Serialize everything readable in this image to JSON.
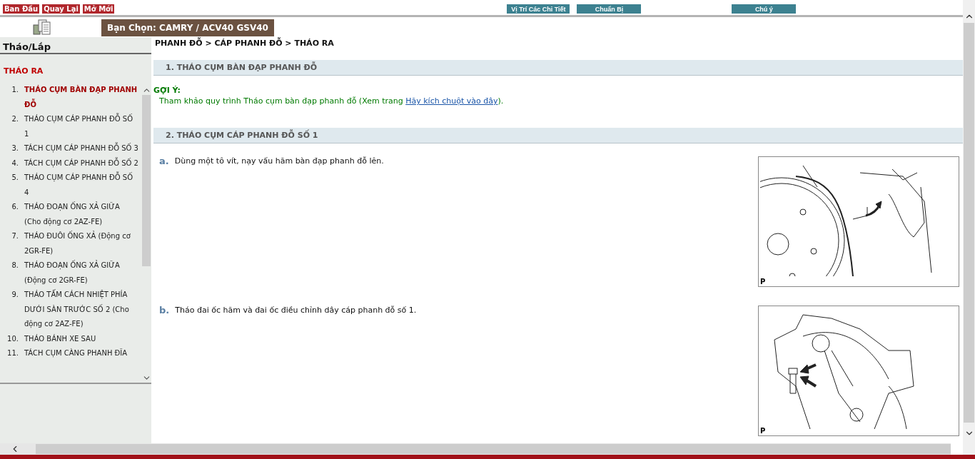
{
  "toolbar": {
    "left_buttons": [
      "Ban Đầu",
      "Quay Lại",
      "Mở Mới"
    ],
    "right_buttons": [
      "Vị Trí Các Chi Tiết",
      "Chuẩn Bị",
      "Chú ý"
    ]
  },
  "selection": "Bạn Chọn: CAMRY / ACV40 GSV40",
  "sidebar": {
    "title": "Tháo/Lắp",
    "section": "THÁO RA",
    "items": [
      {
        "number": "1.",
        "label": "THÁO CỤM BÀN ĐẠP PHANH ĐỖ",
        "selected": true
      },
      {
        "number": "2.",
        "label": "THÁO CỤM CÁP PHANH ĐỖ SỐ 1",
        "selected": false
      },
      {
        "number": "3.",
        "label": "TÁCH CỤM CÁP PHANH ĐỖ SỐ 3",
        "selected": false
      },
      {
        "number": "4.",
        "label": "TÁCH CỤM CÁP PHANH ĐỖ SỐ 2",
        "selected": false
      },
      {
        "number": "5.",
        "label": "THÁO CỤM CÁP PHANH ĐỖ SỐ 4",
        "selected": false
      },
      {
        "number": "6.",
        "label": "THÁO ĐOẠN ỐNG XẢ GIỮA (Cho động cơ 2AZ-FE)",
        "selected": false
      },
      {
        "number": "7.",
        "label": "THÁO ĐUÔI ỐNG XẢ (Động cơ 2GR-FE)",
        "selected": false
      },
      {
        "number": "8.",
        "label": "THÁO ĐOẠN ỐNG XẢ GIỮA (Động cơ 2GR-FE)",
        "selected": false
      },
      {
        "number": "9.",
        "label": "THÁO TẤM CÁCH NHIỆT PHÍA DƯỚI SÀN TRƯỚC SỐ 2 (Cho động cơ 2AZ-FE)",
        "selected": false
      },
      {
        "number": "10.",
        "label": "THÁO BÁNH XE SAU",
        "selected": false
      },
      {
        "number": "11.",
        "label": "TÁCH CỤM CÀNG PHANH ĐĨA",
        "selected": false
      }
    ]
  },
  "breadcrumb": "PHANH ĐỖ > CÁP PHANH ĐỖ > THÁO RA",
  "sections": [
    {
      "heading": "1. THÁO CỤM BÀN ĐẠP PHANH ĐỖ",
      "hint": {
        "label": "GỢI Ý:",
        "text": "Tham khảo quy trình Tháo cụm bàn đạp phanh đỗ (Xem trang ",
        "link": "Hãy kích chuột vào đây",
        "after": ")."
      }
    },
    {
      "heading": "2. THÁO CỤM CÁP PHANH ĐỖ SỐ 1",
      "steps": [
        {
          "letter": "a.",
          "text": "Dùng một tô vít, nạy vấu hãm bàn đạp phanh đỗ lên.",
          "figure_label": "P"
        },
        {
          "letter": "b.",
          "text": "Tháo đai ốc hãm và đai ốc điều chỉnh dây cáp phanh đỗ số 1.",
          "figure_label": "P"
        }
      ]
    }
  ]
}
